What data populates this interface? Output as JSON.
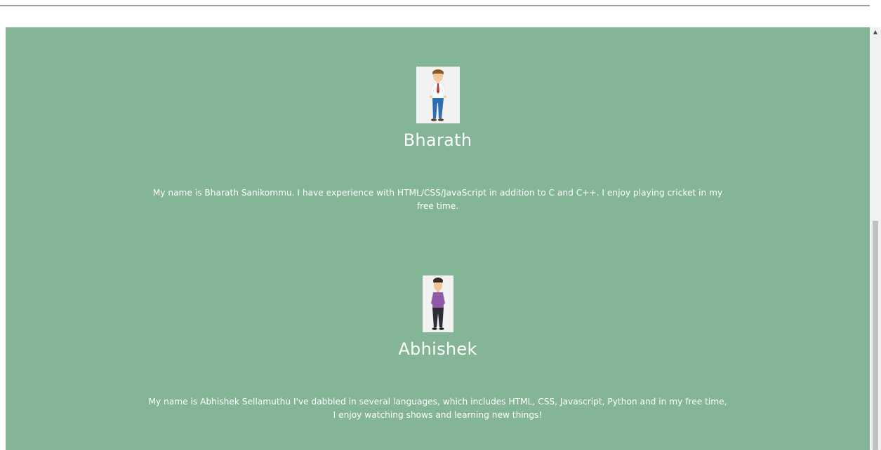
{
  "profiles": [
    {
      "name": "Bharath",
      "bio": "My name is Bharath Sanikommu. I have experience with HTML/CSS/JavaScript in addition to C and C++. I enjoy playing cricket in my free time."
    },
    {
      "name": "Abhishek",
      "bio": "My name is Abhishek Sellamuthu I've dabbled in several languages, which includes HTML, CSS, Javascript, Python and in my free time, I enjoy watching shows and learning new things!"
    }
  ],
  "colors": {
    "section_bg": "#83b596",
    "text": "#ffffff"
  },
  "icons": {
    "scroll_up": "scroll-up-arrow-icon"
  }
}
